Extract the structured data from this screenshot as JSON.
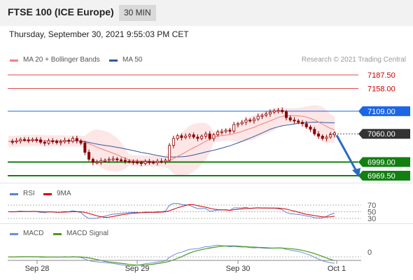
{
  "header": {
    "title": "FTSE 100 (ICE Europe)",
    "interval": "30 MIN"
  },
  "timestamp": "Thursday, September 30, 2021 9:55:03 PM CET",
  "legend": {
    "ma20": "MA 20 + Bollinger Bands",
    "ma50": "MA 50",
    "rsi": "RSI",
    "rsi_signal": "9MA",
    "macd": "MACD",
    "macd_signal": "MACD Signal"
  },
  "credit": "Research © 2021 Trading Central",
  "colors": {
    "ma20": "#f08080",
    "ma50": "#2f5aa0",
    "bollinger": "#fde2e2",
    "resistance": "#cc0000",
    "pivot": "#1a66e6",
    "current": "#333333",
    "support": "#118011",
    "rsi": "#5a7fd6",
    "rsi_signal": "#d40000",
    "macd": "#6a8fe0",
    "macd_signal": "#4a9a1a",
    "arrow": "#2a6bc0"
  },
  "chart_data": {
    "type": "candlestick",
    "price_axis_levels": [
      {
        "label": "7187.50",
        "value": 7187.5,
        "kind": "resistance"
      },
      {
        "label": "7158.00",
        "value": 7158.0,
        "kind": "resistance"
      },
      {
        "label": "7109.00",
        "value": 7109.0,
        "kind": "pivot"
      },
      {
        "label": "7060.00",
        "value": 7060.0,
        "kind": "current"
      },
      {
        "label": "6999.00",
        "value": 6999.0,
        "kind": "support"
      },
      {
        "label": "6969.50",
        "value": 6969.5,
        "kind": "support"
      }
    ],
    "price_range": [
      6955,
      7200
    ],
    "close_path": [
      7044,
      7043,
      7045,
      7048,
      7047,
      7046,
      7048,
      7047,
      7042,
      7040,
      7045,
      7044,
      7041,
      7043,
      7046,
      7044,
      7050,
      7045,
      7040,
      7020,
      7005,
      6998,
      6999,
      7002,
      7003,
      7005,
      7006,
      7004,
      7003,
      7001,
      7000,
      6999,
      6998,
      6996,
      7000,
      6999,
      6998,
      7001,
      7000,
      7003,
      7035,
      7050,
      7056,
      7052,
      7055,
      7058,
      7053,
      7050,
      7055,
      7060,
      7050,
      7058,
      7064,
      7065,
      7068,
      7066,
      7080,
      7082,
      7085,
      7090,
      7088,
      7092,
      7098,
      7100,
      7103,
      7107,
      7110,
      7111,
      7108,
      7095,
      7090,
      7088,
      7085,
      7082,
      7075,
      7070,
      7060,
      7055,
      7050,
      7053,
      7058,
      7062
    ],
    "x_ticks": [
      "Sep 28",
      "Sep 29",
      "Sep 30",
      "Oct 1"
    ],
    "projection": {
      "from": 7060,
      "to": 6969.5
    },
    "rsi": {
      "levels": [
        "70",
        "50",
        "30"
      ]
    },
    "macd": {
      "levels": [
        "0"
      ]
    }
  }
}
